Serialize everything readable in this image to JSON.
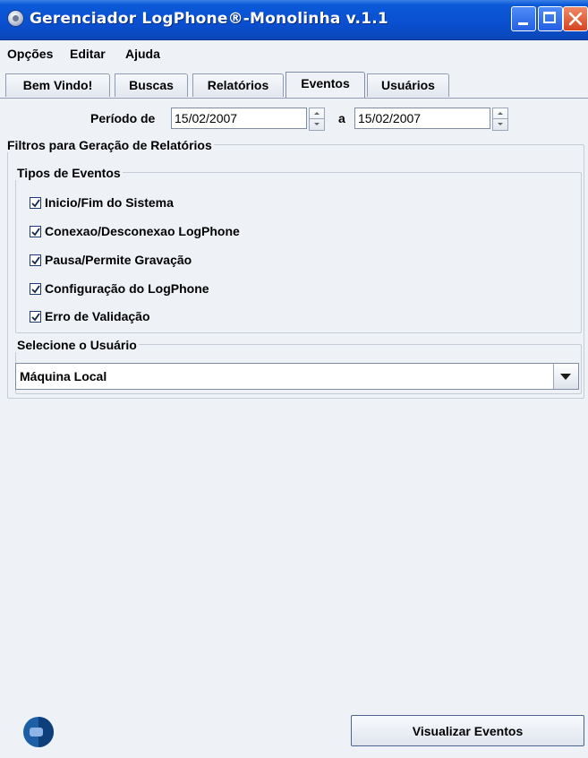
{
  "window": {
    "title": "Gerenciador LogPhone®-Monolinha v.1.1"
  },
  "menu": {
    "items": [
      "Opções",
      "Editar",
      "Ajuda"
    ]
  },
  "tabs": [
    {
      "label": "Bem Vindo!",
      "active": false
    },
    {
      "label": "Buscas",
      "active": false
    },
    {
      "label": "Relatórios",
      "active": false
    },
    {
      "label": "Eventos",
      "active": true
    },
    {
      "label": "Usuários",
      "active": false
    }
  ],
  "period": {
    "label": "Período de",
    "from": "15/02/2007",
    "separator": "a",
    "to": "15/02/2007"
  },
  "filters": {
    "title": "Filtros para Geração de Relatórios",
    "event_types": {
      "title": "Tipos de Eventos",
      "items": [
        {
          "label": "Inicio/Fim do Sistema",
          "checked": true
        },
        {
          "label": "Conexao/Desconexao LogPhone",
          "checked": true
        },
        {
          "label": "Pausa/Permite Gravação",
          "checked": true
        },
        {
          "label": "Configuração do LogPhone",
          "checked": true
        },
        {
          "label": "Erro de Validação",
          "checked": true
        }
      ]
    },
    "user": {
      "title": "Selecione o Usuário",
      "selected": "Máquina Local"
    }
  },
  "actions": {
    "view_events": "Visualizar Eventos"
  },
  "colors": {
    "titlebar": "#0a4fd0",
    "window_bg": "#eef1f6",
    "border": "#7f8ca3"
  }
}
